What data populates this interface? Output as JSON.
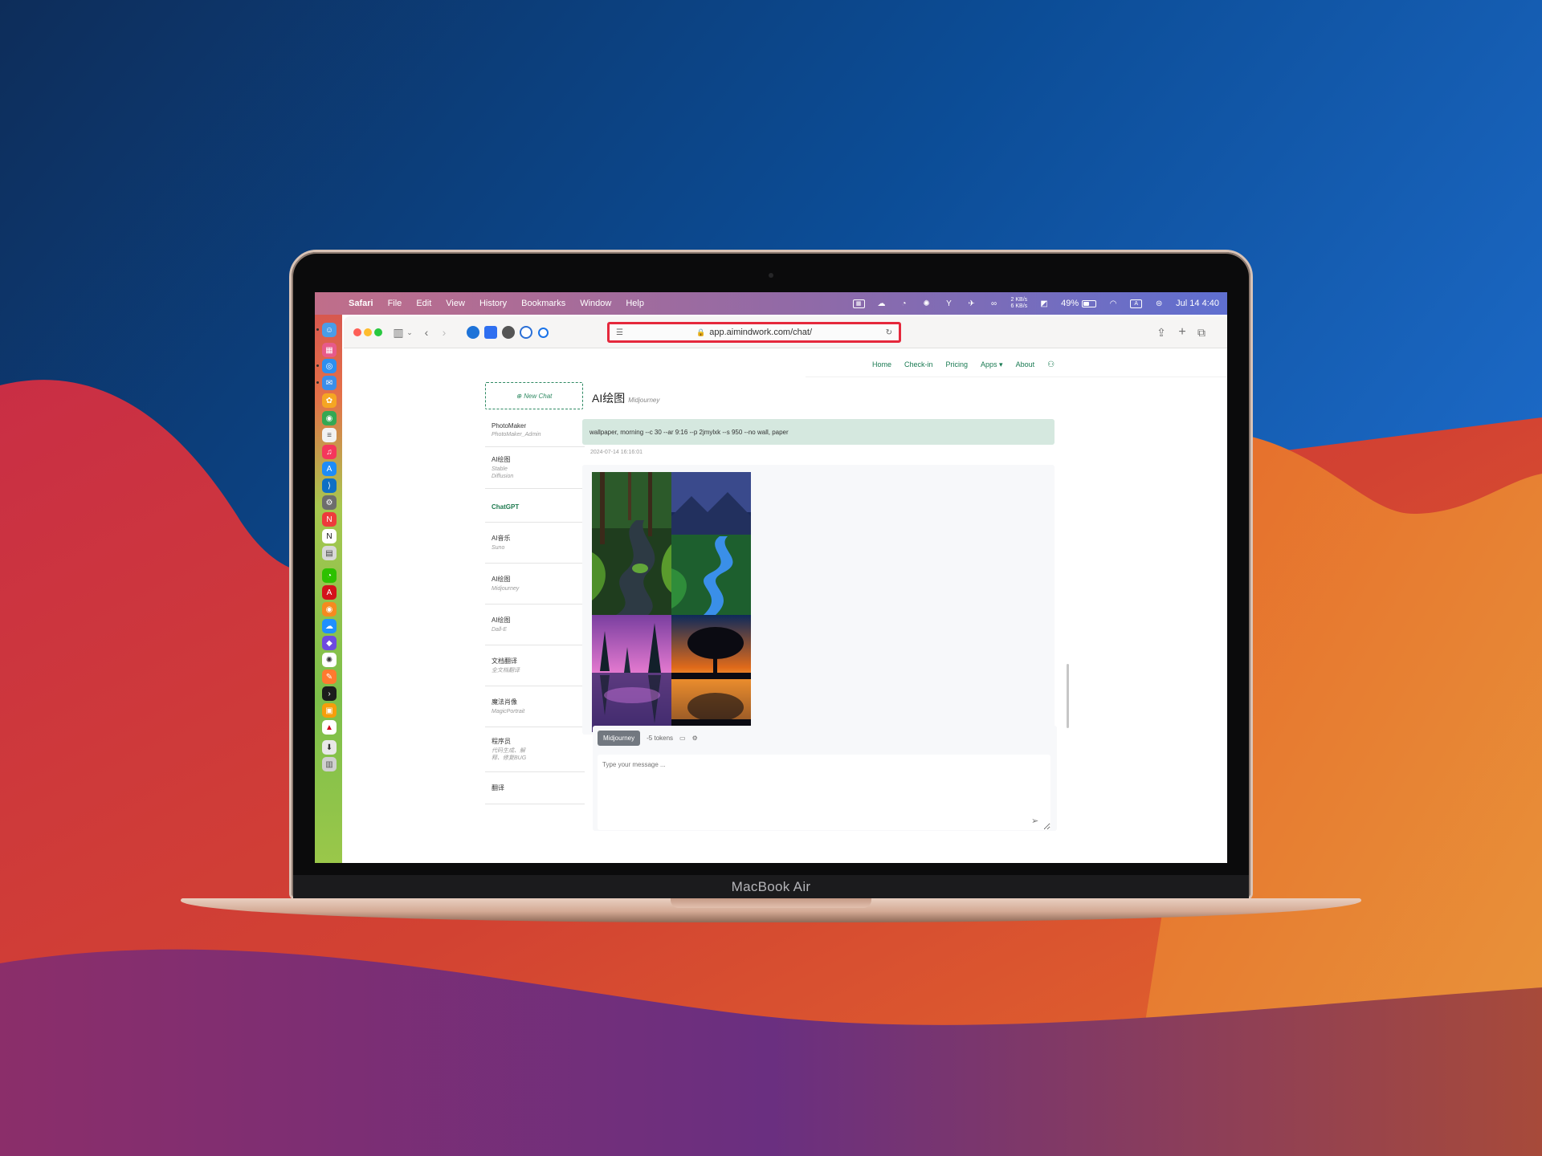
{
  "menubar": {
    "app": "Safari",
    "items": [
      "File",
      "Edit",
      "View",
      "History",
      "Bookmarks",
      "Window",
      "Help"
    ],
    "net_up": "2 KB/s",
    "net_down": "6 KB/s",
    "battery": "49%",
    "battery_level": 0.49,
    "input_method": "A",
    "clock": "Jul 14  4:40"
  },
  "safari": {
    "url": "app.aimindwork.com/chat/"
  },
  "topnav": {
    "items": [
      "Home",
      "Check-in",
      "Pricing",
      "Apps ▾",
      "About"
    ]
  },
  "sidebar": {
    "new_chat": "New Chat",
    "items": [
      {
        "title": "PhotoMaker",
        "subtitle": "PhotoMaker_Admin"
      },
      {
        "title": "AI绘图",
        "subtitle": "Stable Diffusion"
      },
      {
        "title": "ChatGPT",
        "subtitle": ""
      },
      {
        "title": "AI音乐",
        "subtitle": "Suno"
      },
      {
        "title": "AI绘图",
        "subtitle": "Midjourney"
      },
      {
        "title": "AI绘图",
        "subtitle": "Dall-E"
      },
      {
        "title": "文档翻译",
        "subtitle": "全文档翻译"
      },
      {
        "title": "魔法肖像",
        "subtitle": "MagicPortrait"
      },
      {
        "title": "程序员",
        "subtitle": "代码生成、解释、修复BUG"
      },
      {
        "title": "翻译",
        "subtitle": ""
      }
    ]
  },
  "main": {
    "title": "AI绘图",
    "subtitle": "Midjourney",
    "prompt": "wallpaper, morning  --c 30 --ar 9:16 --p 2jmylxk --s 950 --no wall, paper",
    "timestamp": "2024-07-14 16:16:01"
  },
  "composer": {
    "model": "Midjourney",
    "tokens": "-5 tokens",
    "placeholder": "Type your message ..."
  },
  "laptop": {
    "label": "MacBook Air"
  },
  "colors": {
    "accent": "#197a52",
    "prompt_bg": "#d5e8df",
    "highlight": "#e5283c"
  }
}
